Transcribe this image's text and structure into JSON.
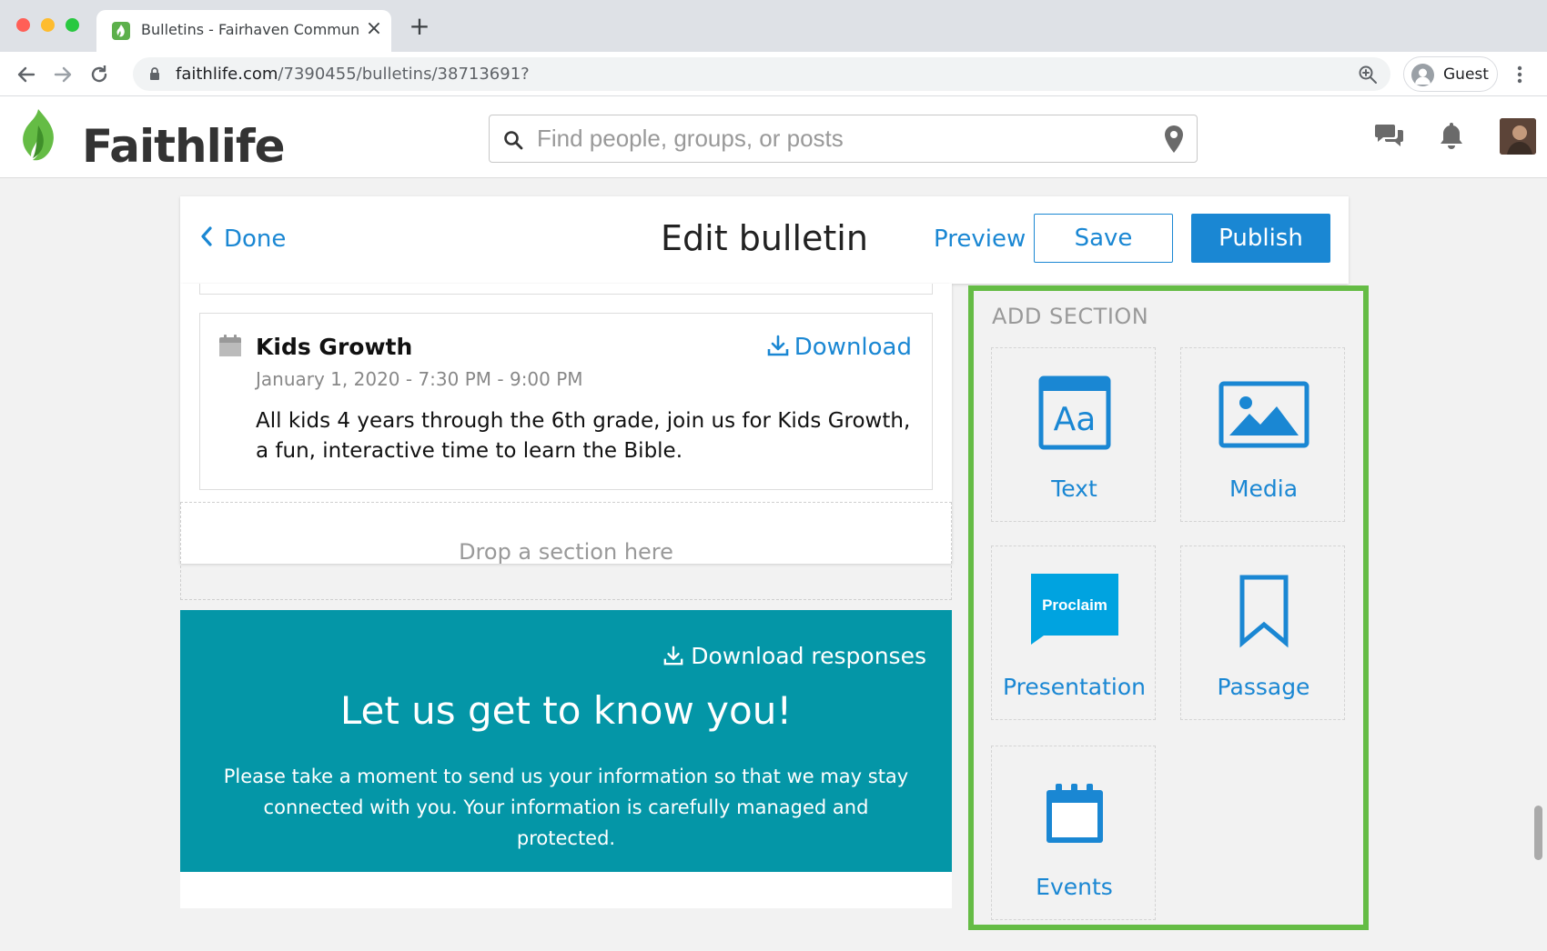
{
  "browser": {
    "tab_title": "Bulletins - Fairhaven Community",
    "url_main": "faithlife.com",
    "url_path": "/7390455/bulletins/38713691?",
    "profile_label": "Guest"
  },
  "site": {
    "logo_text": "Faithlife",
    "search_placeholder": "Find people, groups, or posts"
  },
  "editbar": {
    "done_label": "Done",
    "title": "Edit bulletin",
    "preview_label": "Preview",
    "save_label": "Save",
    "publish_label": "Publish"
  },
  "event": {
    "title": "Kids Growth",
    "download_label": "Download",
    "date": "January 1, 2020 - 7:30 PM - 9:00 PM",
    "description": "All kids 4 years through the 6th grade, join us for Kids Growth, a fun, interactive time to learn the Bible."
  },
  "drop_zone": {
    "label": "Drop a section here"
  },
  "form": {
    "download_label": "Download responses",
    "title": "Let us get to know you!",
    "description": "Please take a moment to send us your information so that we may stay connected with you. Your information is carefully managed and protected."
  },
  "add_section": {
    "title": "ADD SECTION",
    "tiles": [
      {
        "label": "Text",
        "icon": "text-aa-icon"
      },
      {
        "label": "Media",
        "icon": "image-icon"
      },
      {
        "label": "Presentation",
        "icon": "proclaim-icon",
        "badge": "Proclaim"
      },
      {
        "label": "Passage",
        "icon": "bookmark-icon"
      },
      {
        "label": "Events",
        "icon": "calendar-icon"
      }
    ]
  },
  "colors": {
    "accent": "#1a87d3",
    "brand_green": "#65bc45",
    "form_teal": "#0496a7"
  }
}
